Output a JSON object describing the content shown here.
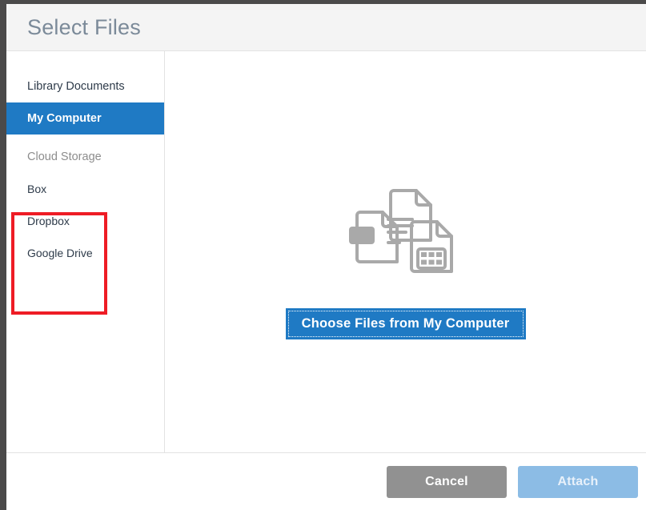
{
  "dialog": {
    "title": "Select Files"
  },
  "sidebar": {
    "items": [
      {
        "label": "Library Documents",
        "type": "nav",
        "active": false
      },
      {
        "label": "My Computer",
        "type": "nav",
        "active": true
      }
    ],
    "section_header": "Cloud Storage",
    "cloud_items": [
      {
        "label": "Box"
      },
      {
        "label": "Dropbox"
      },
      {
        "label": "Google Drive"
      }
    ]
  },
  "content": {
    "illustration_name": "documents-illustration",
    "choose_files_label": "Choose Files from My Computer"
  },
  "footer": {
    "cancel_label": "Cancel",
    "attach_label": "Attach"
  },
  "colors": {
    "accent_blue": "#1f7ac4",
    "attach_disabled_blue": "#8cbce5",
    "cancel_gray": "#919191",
    "annotation_red": "#ee1c25",
    "header_bg": "#f4f4f4",
    "title_text": "#7b8a99",
    "illustration_gray": "#a9a9a9"
  }
}
